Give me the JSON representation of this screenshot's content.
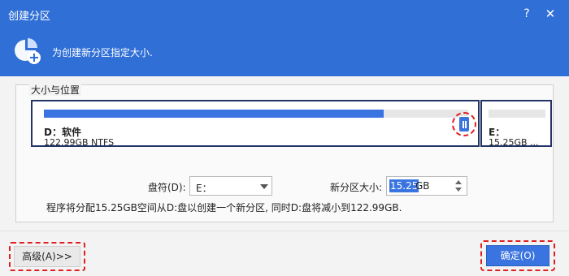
{
  "window": {
    "title": "创建分区",
    "help_label": "?",
    "close_label": "✕"
  },
  "banner": {
    "text": "为创建新分区指定大小.",
    "icon": "pie-chart-add-icon"
  },
  "group": {
    "label": "大小与位置"
  },
  "partitions": [
    {
      "name": "D：软件",
      "info": "122.99GB NTFS",
      "used_fraction": 0.8
    },
    {
      "name": "E：",
      "info": "15.25GB ...",
      "used_fraction": 0
    }
  ],
  "form": {
    "drive_label": "盘符(D):",
    "drive_value": "E：",
    "size_label": "新分区大小:",
    "size_value": "15.25",
    "size_unit": "GB"
  },
  "info_text": "程序将分配15.25GB空间从D:盘以创建一个新分区, 同时D:盘将减小到122.99GB.",
  "buttons": {
    "advanced": "高级(A)>>",
    "ok": "确定(O)"
  },
  "colors": {
    "accent": "#2f6fd6",
    "bar": "#3a74e0",
    "highlight": "#e02020",
    "border": "#223366"
  }
}
